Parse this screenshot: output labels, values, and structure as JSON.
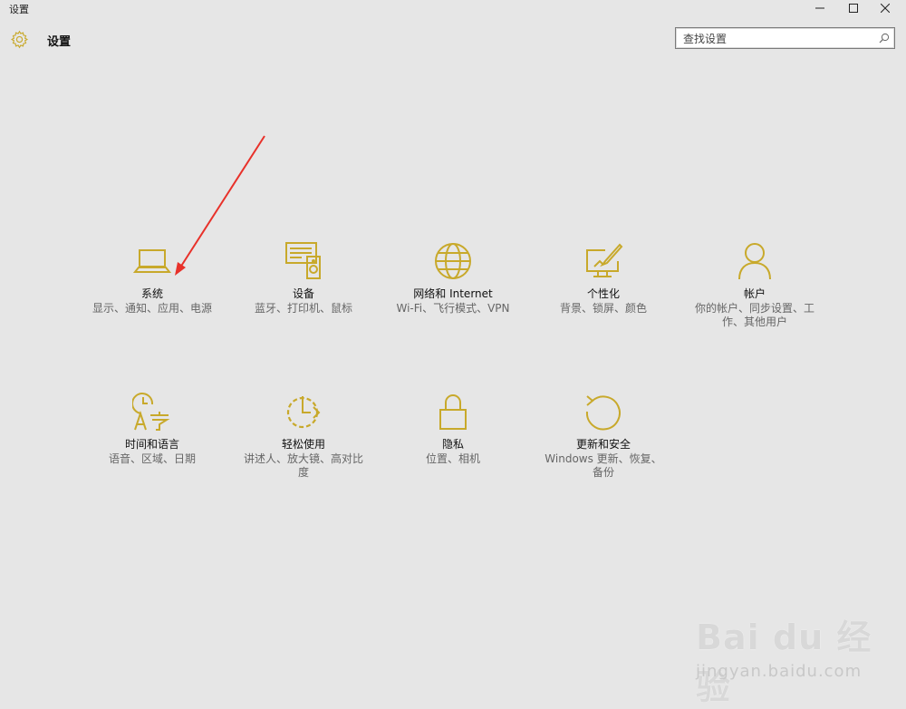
{
  "window": {
    "title": "设置",
    "controls": {
      "minimize": "minimize-icon",
      "maximize": "maximize-icon",
      "close": "close-icon"
    }
  },
  "header": {
    "icon": "gear-icon",
    "title": "设置"
  },
  "search": {
    "placeholder": "查找设置",
    "icon": "search-icon"
  },
  "accent_color": "#c8a92b",
  "tiles": [
    {
      "label": "系统",
      "desc": "显示、通知、应用、电源",
      "icon": "laptop-icon"
    },
    {
      "label": "设备",
      "desc": "蓝牙、打印机、鼠标",
      "icon": "devices-icon"
    },
    {
      "label": "网络和 Internet",
      "desc": "Wi-Fi、飞行模式、VPN",
      "icon": "globe-icon"
    },
    {
      "label": "个性化",
      "desc": "背景、锁屏、颜色",
      "icon": "personalization-icon"
    },
    {
      "label": "帐户",
      "desc": "你的帐户、同步设置、工作、其他用户",
      "icon": "person-icon"
    },
    {
      "label": "时间和语言",
      "desc": "语音、区域、日期",
      "icon": "time-language-icon"
    },
    {
      "label": "轻松使用",
      "desc": "讲述人、放大镜、高对比度",
      "icon": "ease-of-access-icon"
    },
    {
      "label": "隐私",
      "desc": "位置、相机",
      "icon": "lock-icon"
    },
    {
      "label": "更新和安全",
      "desc": "Windows 更新、恢复、备份",
      "icon": "refresh-icon"
    }
  ],
  "annotation": {
    "color": "#e8312a"
  },
  "watermark": {
    "brand": "Bai du 经验",
    "url": "jingyan.baidu.com"
  }
}
